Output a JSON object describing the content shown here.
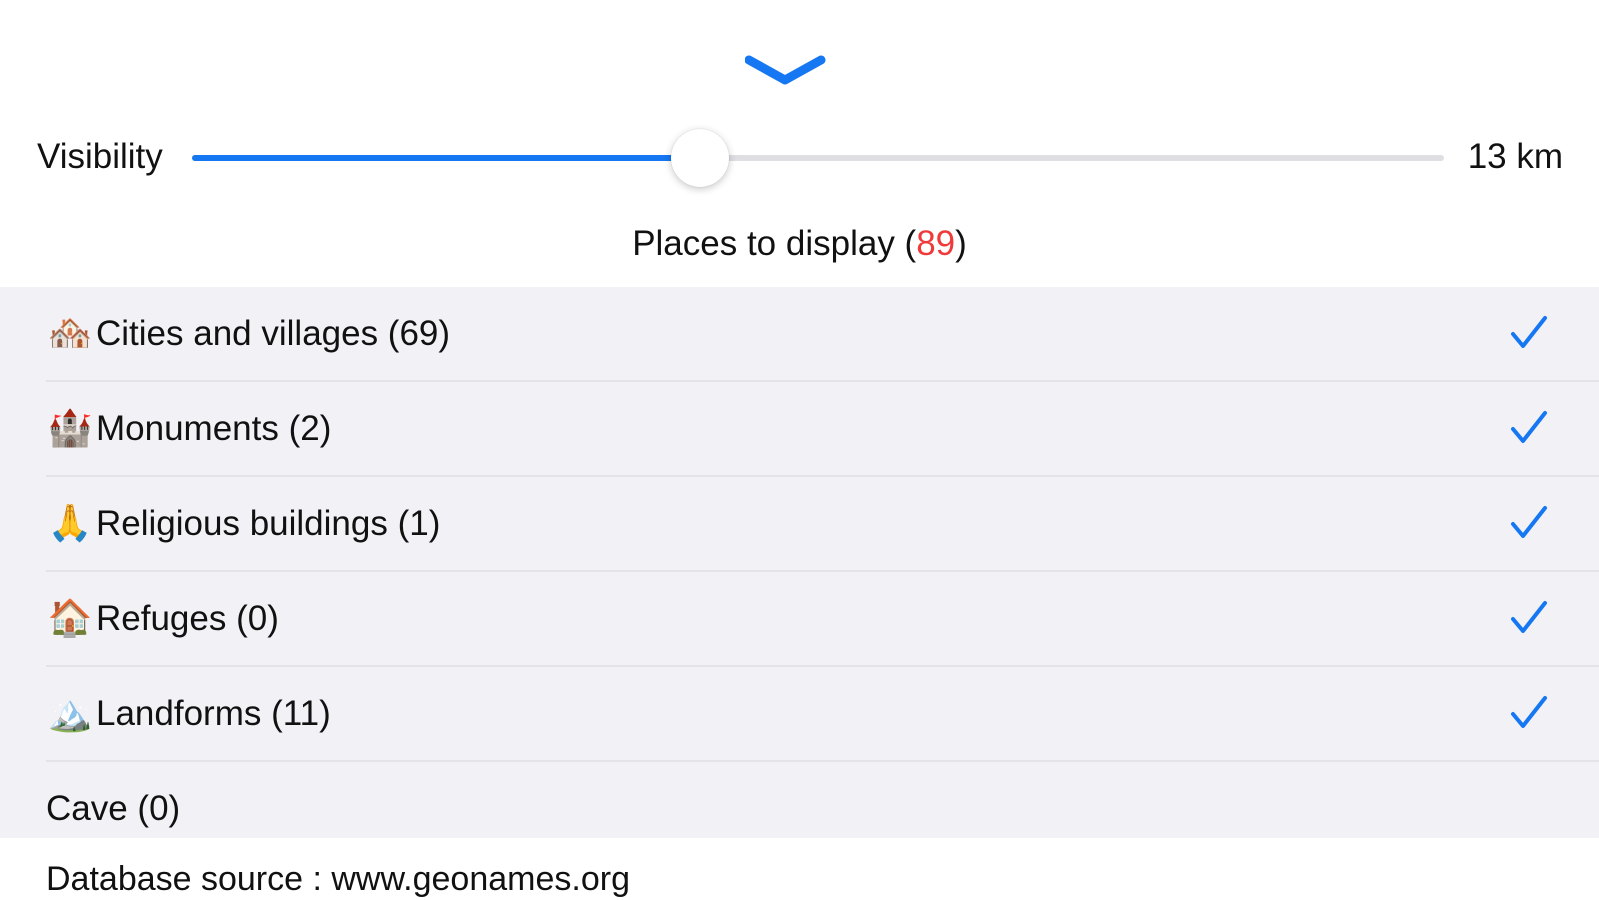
{
  "header": {
    "collapse_icon": "chevron-down-icon"
  },
  "visibility": {
    "label": "Visibility",
    "value_text": "13 km",
    "slider_fraction": 0.406,
    "accent_color": "#1677f2"
  },
  "places": {
    "title_prefix": "Places to display (",
    "count": "89",
    "title_suffix": ")",
    "count_color": "#f03a3a"
  },
  "categories": [
    {
      "icon": "🏘️",
      "icon_name": "houses-icon",
      "label": "Cities and villages (69)",
      "checked": true
    },
    {
      "icon": "🏰",
      "icon_name": "castle-icon",
      "label": "Monuments (2)",
      "checked": true
    },
    {
      "icon": "🙏",
      "icon_name": "praying-hands-icon",
      "label": "Religious buildings (1)",
      "checked": true
    },
    {
      "icon": "🏠",
      "icon_name": "house-icon",
      "label": "Refuges (0)",
      "checked": true
    },
    {
      "icon": "🏔️",
      "icon_name": "mountain-icon",
      "label": "Landforms (11)",
      "checked": true
    },
    {
      "icon": "",
      "icon_name": "",
      "label": "Cave (0)",
      "checked": false
    }
  ],
  "footer": {
    "source_text": "Database source : www.geonames.org"
  }
}
